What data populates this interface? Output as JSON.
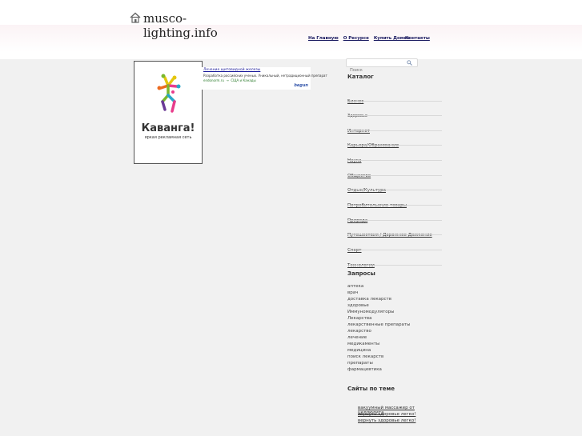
{
  "site": {
    "name": "musco-lighting.info"
  },
  "topnav": {
    "home": "На Главную",
    "about": "О Ресурсе",
    "buy": "Купить Домен",
    "contacts": "Контакты"
  },
  "search": {
    "placeholder": "Поиск"
  },
  "banner": {
    "brand": "Кавaнга!",
    "slogan": "яркая рекламная сеть"
  },
  "ad": {
    "title": "Лечение щитовидной железы",
    "description": "Разработка российских ученых. Уникальный, нетрадиционный препарат",
    "url": "endonorm.ru",
    "region": "СЩА и Канады",
    "provider": "begun"
  },
  "catalog": {
    "title": "Каталог",
    "items": [
      "Бизнес",
      "Здоровье",
      "Интернет",
      "Карьера/Образование",
      "Наука",
      "Общество",
      "Отдых/Культура",
      "Потребительские товары",
      "Природа",
      "Путешествия / Дорожное Движение",
      "Спорт",
      "Технологии"
    ]
  },
  "queries": {
    "title": "Запросы",
    "items": [
      "аптека",
      "врач",
      "доставка лекарств",
      "здоровье",
      "Иммуномодуляторы",
      "Лекарства",
      "лекарственные препараты",
      "лекарство",
      "лечение",
      "медикаменты",
      "медицина",
      "поиск лекарств",
      "препараты",
      "фармацевтика"
    ]
  },
  "related": {
    "title": "Сайты по теме",
    "items": [
      "вакуумный массажер от целлюлита",
      "вернуть здоровье легко!",
      "вернуть здоровье легко!"
    ]
  }
}
